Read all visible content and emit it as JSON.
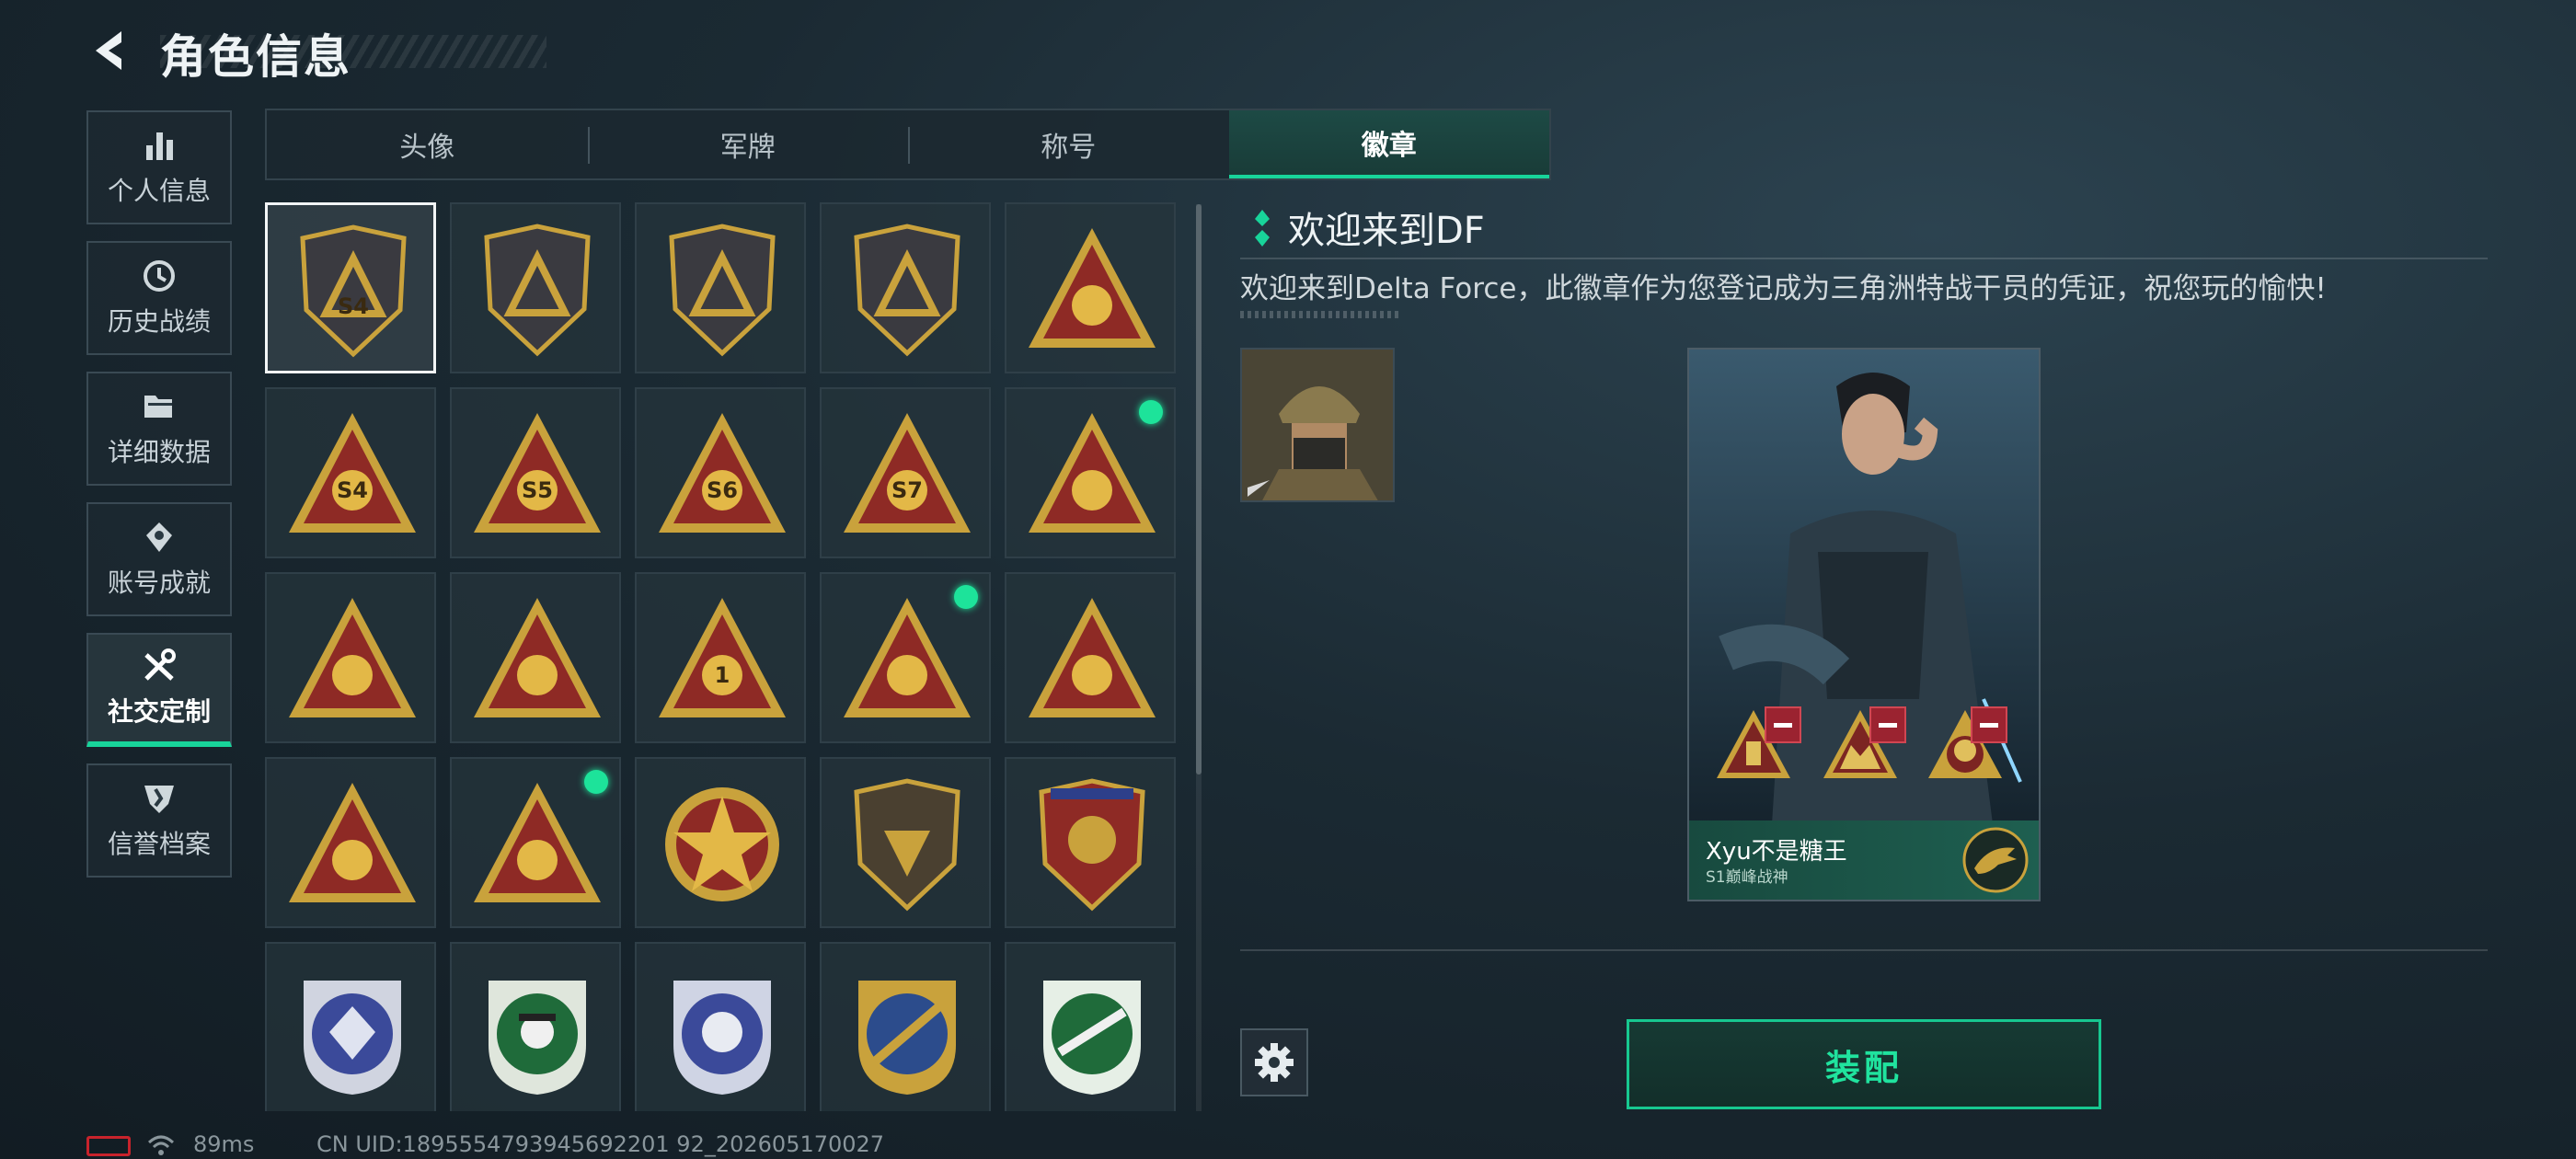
{
  "header": {
    "title": "角色信息",
    "back_icon": "back-arrow-icon"
  },
  "sidebar": {
    "items": [
      {
        "label": "个人信息",
        "icon": "bar-chart-icon",
        "active": false
      },
      {
        "label": "历史战绩",
        "icon": "history-clock-icon",
        "active": false
      },
      {
        "label": "详细数据",
        "icon": "folder-icon",
        "active": false
      },
      {
        "label": "账号成就",
        "icon": "achievement-icon",
        "active": false
      },
      {
        "label": "社交定制",
        "icon": "tools-icon",
        "active": true
      },
      {
        "label": "信誉档案",
        "icon": "credit-shield-icon",
        "active": false
      }
    ]
  },
  "tabs": [
    {
      "label": "头像",
      "active": false
    },
    {
      "label": "军牌",
      "active": false
    },
    {
      "label": "称号",
      "active": false
    },
    {
      "label": "徽章",
      "active": true
    }
  ],
  "badges": {
    "selected_index": 0,
    "new_dot_indices": [
      9,
      13,
      16
    ],
    "items": [
      {
        "label": "S4",
        "icon": "badge-delta-shield-icon"
      },
      {
        "label": "",
        "icon": "badge-helicopter-icon"
      },
      {
        "label": "",
        "icon": "badge-diamond-shield-icon"
      },
      {
        "label": "",
        "icon": "badge-dagger-shield-icon"
      },
      {
        "label": "",
        "icon": "badge-gyroscope-triangle-icon"
      },
      {
        "label": "S4",
        "icon": "badge-s4-icon"
      },
      {
        "label": "S5",
        "icon": "badge-s5-icon"
      },
      {
        "label": "S6",
        "icon": "badge-s6-icon"
      },
      {
        "label": "S7",
        "icon": "badge-s7-icon"
      },
      {
        "label": "",
        "icon": "badge-skull-triangle-icon"
      },
      {
        "label": "",
        "icon": "badge-boat-triangle-icon"
      },
      {
        "label": "",
        "icon": "badge-tank-triangle-icon"
      },
      {
        "label": "1",
        "icon": "badge-number-one-icon"
      },
      {
        "label": "",
        "icon": "badge-usb-triangle-icon"
      },
      {
        "label": "",
        "icon": "badge-d20-triangle-icon"
      },
      {
        "label": "",
        "icon": "badge-soldiers-triangle-icon"
      },
      {
        "label": "",
        "icon": "badge-wolves-triangle-icon"
      },
      {
        "label": "",
        "icon": "badge-star-emblem-icon"
      },
      {
        "label": "",
        "icon": "badge-bronze-shield-icon"
      },
      {
        "label": "",
        "icon": "badge-stars-shield-icon"
      },
      {
        "label": "",
        "icon": "badge-blue-gem-icon"
      },
      {
        "label": "",
        "icon": "badge-green-spy-icon"
      },
      {
        "label": "",
        "icon": "badge-silver-skull-icon"
      },
      {
        "label": "",
        "icon": "badge-gold-rifle-icon"
      },
      {
        "label": "",
        "icon": "badge-green-rifle-icon"
      }
    ]
  },
  "detail": {
    "name": "欢迎来到DF",
    "description": "欢迎来到Delta Force，此徽章作为您登记成为三角洲特战干员的凭证，祝您玩的愉快!",
    "avatar_icon": "operator-avatar-icon"
  },
  "card": {
    "player_name": "Xyu不是糖王",
    "subtitle": "S1巅峰战神",
    "slots": 3,
    "emblem_icon": "crocodile-emblem-icon"
  },
  "actions": {
    "settings_icon": "gear-icon",
    "equip_label": "装配"
  },
  "footer": {
    "ping": "89ms",
    "uid": "CN UID:18955547939456922019 2_202605170027",
    "uid_exact": "CN UID:1895554793945692201 92_202605170027"
  },
  "colors": {
    "accent": "#18d49a",
    "gold": "#c9a23c",
    "red_badge": "#8e2a25"
  }
}
